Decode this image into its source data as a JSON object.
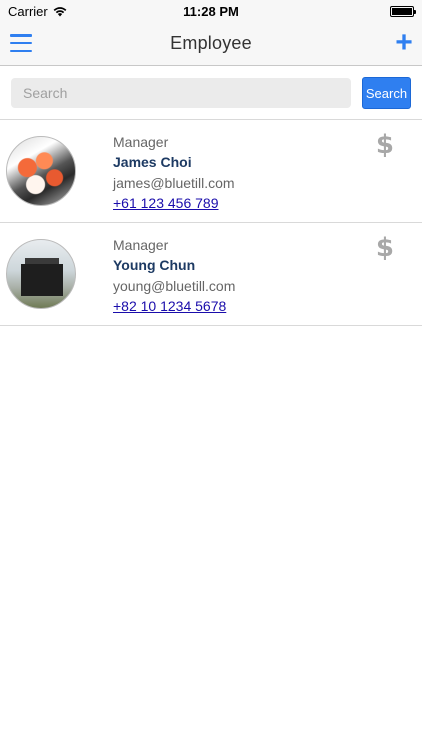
{
  "status_bar": {
    "carrier": "Carrier",
    "time": "11:28 PM",
    "battery_level": 1.0
  },
  "nav": {
    "title": "Employee",
    "menu_icon": "hamburger-menu-icon",
    "add_icon": "plus-icon",
    "add_symbol": "+"
  },
  "search": {
    "placeholder": "Search",
    "value": "",
    "button_label": "Search"
  },
  "employees": [
    {
      "role": "Manager",
      "name": "James Choi",
      "email": "james@bluetill.com",
      "phone": "+61 123 456 789",
      "avatar_icon": "sushi-photo",
      "action_symbol": "$"
    },
    {
      "role": "Manager",
      "name": "Young Chun",
      "email": "young@bluetill.com",
      "phone": "+82 10 1234 5678",
      "avatar_icon": "box-photo",
      "action_symbol": "$"
    }
  ],
  "colors": {
    "accent": "#2f7ff0",
    "name_text": "#1d3a63",
    "link": "#1a0dab",
    "dollar_icon": "#a8a8a8"
  }
}
